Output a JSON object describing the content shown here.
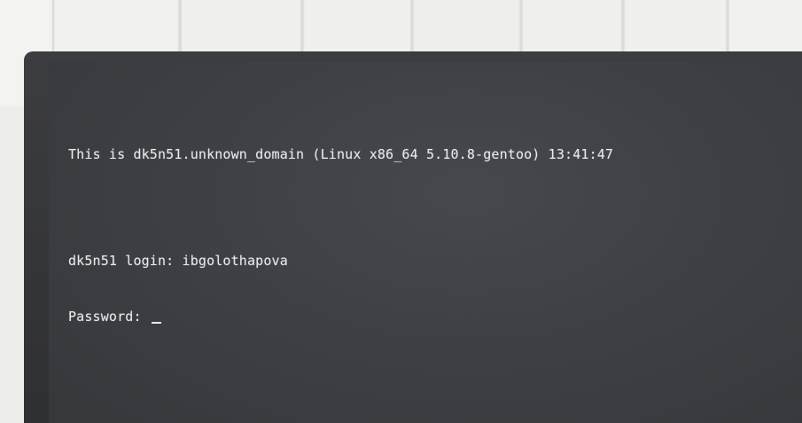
{
  "terminal": {
    "banner": "This is dk5n51.unknown_domain (Linux x86_64 5.10.8-gentoo) 13:41:47",
    "login_prompt": "dk5n51 login: ",
    "login_value": "ibgolothapova",
    "password_prompt": "Password: "
  },
  "colors": {
    "screen_background": "#3d4044",
    "text": "#e7e9ea",
    "bezel": "#333437"
  },
  "icons": [
    "text-cursor-icon"
  ]
}
